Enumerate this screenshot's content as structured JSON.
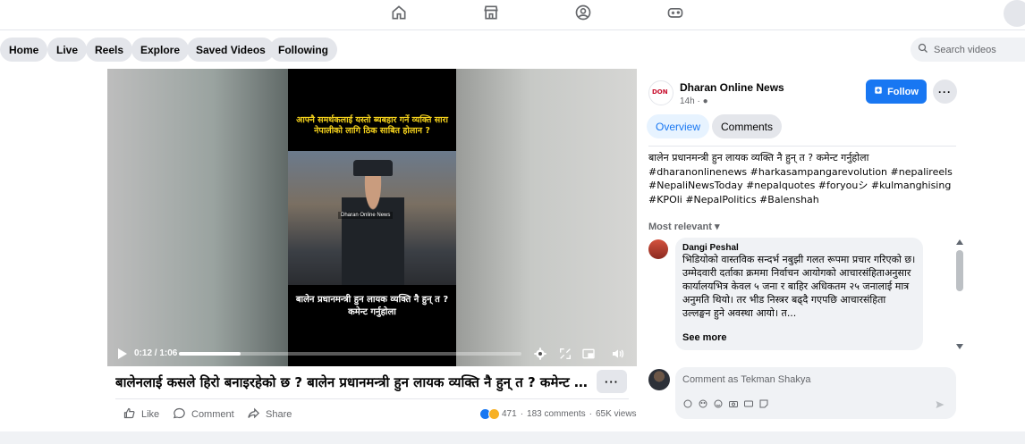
{
  "nav": {
    "icons": [
      "home-icon",
      "marketplace-icon",
      "groups-icon",
      "gaming-icon"
    ]
  },
  "subnav": {
    "pills": [
      "Home",
      "Live",
      "Reels",
      "Explore",
      "Saved Videos",
      "Following"
    ],
    "search_placeholder": "Search videos"
  },
  "video": {
    "caption_top": "आफ्नै समर्थकलाई यस्तो ब्यबहार गर्ने व्यक्ति सारा नेपालीको लागि ठिक साबित होलान ?",
    "watermark": "Dharan Online News",
    "caption_bottom": "बालेन प्रधानमन्त्री हुन लायक व्यक्ति नै हुन् त ? कमेन्ट गर्नुहोला",
    "time": "0:12 / 1:06",
    "progress": 0.18
  },
  "post": {
    "title": "बालेनलाई कसले हिरो बनाइरहेको छ ? बालेन प्रधानमन्त्री हुन लायक व्यक्ति नै हुन् त ? कमेन्ट गर्नुहोला",
    "more_label": "···",
    "actions": {
      "like": "Like",
      "comment": "Comment",
      "share": "Share"
    },
    "reactions_count": "471",
    "comments_count": "183 comments",
    "views": "65K views",
    "stats_sep": "·"
  },
  "side": {
    "logo_text": "DON",
    "page_name": "Dharan Online News",
    "time": "14h",
    "time_sep": "·",
    "follow_label": "Follow",
    "more_label": "···",
    "tabs": [
      "Overview",
      "Comments"
    ],
    "description": "बालेन प्रधानमन्त्री हुन लायक व्यक्ति नै हुन् त ? कमेन्ट गर्नुहोला #dharanonlinenews #harkasampangarevolution #nepalireels #NepaliNewsToday #nepalquotes #foryouシ #kulmanghising #KPOli #NepalPolitics #Balenshah",
    "sort_label": "Most relevant",
    "comment": {
      "author": "Dangi Peshal",
      "text": "भिडियोको वास्तविक सन्दर्भ नबुझी गलत रूपमा प्रचार गरिएको छ। उम्मेदवारी दर्ताका क्रममा निर्वाचन आयोगको आचारसंहिताअनुसार कार्यालयभित्र केवल ५ जना र बाहिर अधिकतम २५ जनालाई मात्र अनुमति थियो। तर भीड निस्त्रर बढ्दै गएपछि आचारसंहिता उल्लङ्घन हुने अवस्था आयो। त...",
      "see_more": "See more"
    },
    "composer_placeholder": "Comment as Tekman Shakya"
  },
  "colors": {
    "accent": "#1877f2",
    "pill_bg": "#e4e6eb",
    "muted": "#65676b"
  }
}
